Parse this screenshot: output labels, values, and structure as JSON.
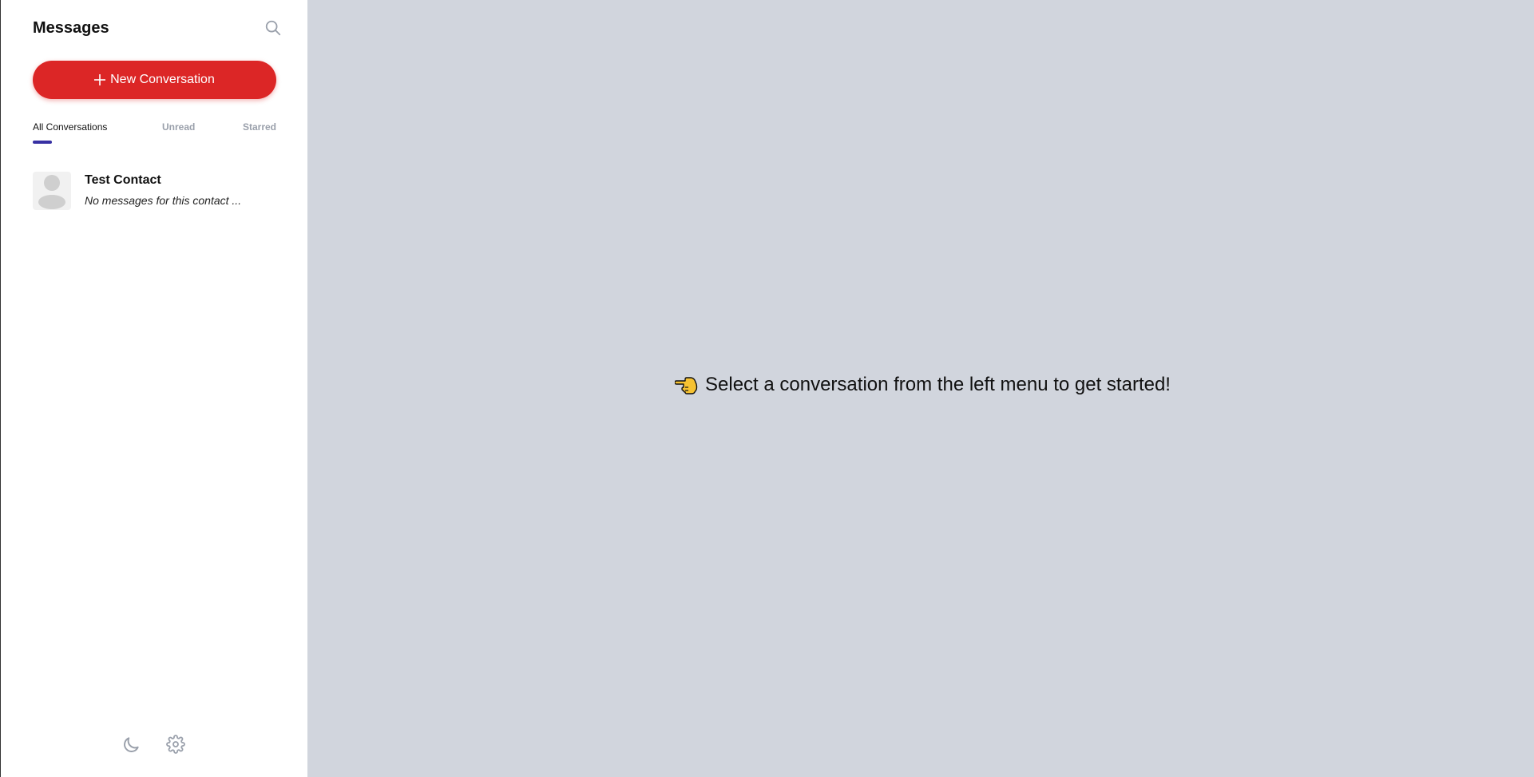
{
  "sidebar": {
    "title": "Messages",
    "new_conversation_label": "New Conversation",
    "tabs": [
      {
        "label": "All Conversations",
        "active": true
      },
      {
        "label": "Unread",
        "active": false
      },
      {
        "label": "Starred",
        "active": false
      }
    ],
    "conversations": [
      {
        "name": "Test Contact",
        "preview": "No messages for this contact ..."
      }
    ],
    "footer_icons": [
      "moon-icon",
      "gear-icon"
    ]
  },
  "main": {
    "empty_message": "Select a conversation from the left menu to get started!",
    "icon": "pointing-hand-icon"
  },
  "colors": {
    "accent": "#dc2626",
    "tab_indicator": "#3730a3",
    "main_bg": "#d1d5dd",
    "sidebar_bg": "#ffffff"
  }
}
